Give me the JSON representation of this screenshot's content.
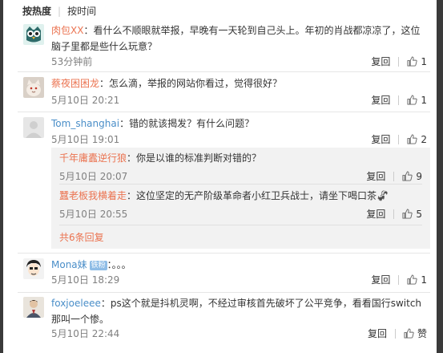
{
  "sort_tabs": {
    "hot": "按热度",
    "time": "按时间"
  },
  "reply_label": "复回",
  "comments": [
    {
      "user": "肉包XX",
      "text": "：看什么不顺眼就举报，早晚有一天轮到自己头上。年初的肖战都凉凉了，这位脑子里都是些什么玩意？",
      "time": "53分钟前",
      "likes": "1",
      "avatar_icon": "owl-avatar-icon"
    },
    {
      "user": "蔡夜困困龙",
      "text": "：怎么滴，举报的网站你看过，觉得很好？",
      "time": "5月10日 20:21",
      "likes": "1",
      "avatar_icon": "cat-avatar-icon"
    },
    {
      "user": "Tom_shanghai",
      "text": "：错的就该揭发？有什么问题？",
      "time": "5月10日 19:01",
      "likes": "2",
      "avatar_icon": "default-avatar-icon",
      "replies": [
        {
          "user": "千年庸蠹逆行狼",
          "text": "：你是以谁的标准判断对错的？",
          "time": "5月10日 20:07",
          "likes": "9"
        },
        {
          "user": "蠶老板我横着走",
          "text": "：这位坚定的无产阶级革命者小红卫兵战士，请坐下喝口茶🦨",
          "time": "5月10日 20:55",
          "likes": "5"
        }
      ],
      "more_replies": "共6条回复"
    },
    {
      "user": "Mona妹",
      "badge": "铁粉",
      "text": "：。。。",
      "time": "5月10日 18:29",
      "likes": "1",
      "avatar_icon": "manga-avatar-icon"
    },
    {
      "user": "foxjoeleee",
      "text": "：ps这个就是抖机灵啊，不经过审核首先破坏了公平竞争，看看国行switch那叫一个惨。",
      "time": "5月10日 22:44",
      "likes": "赞",
      "avatar_icon": "photo-avatar-icon"
    }
  ],
  "colors": {
    "username": "#eb7350",
    "username_alt": "#4a8ec8",
    "meta": "#808080",
    "sub_bg": "#f2f2f2"
  }
}
